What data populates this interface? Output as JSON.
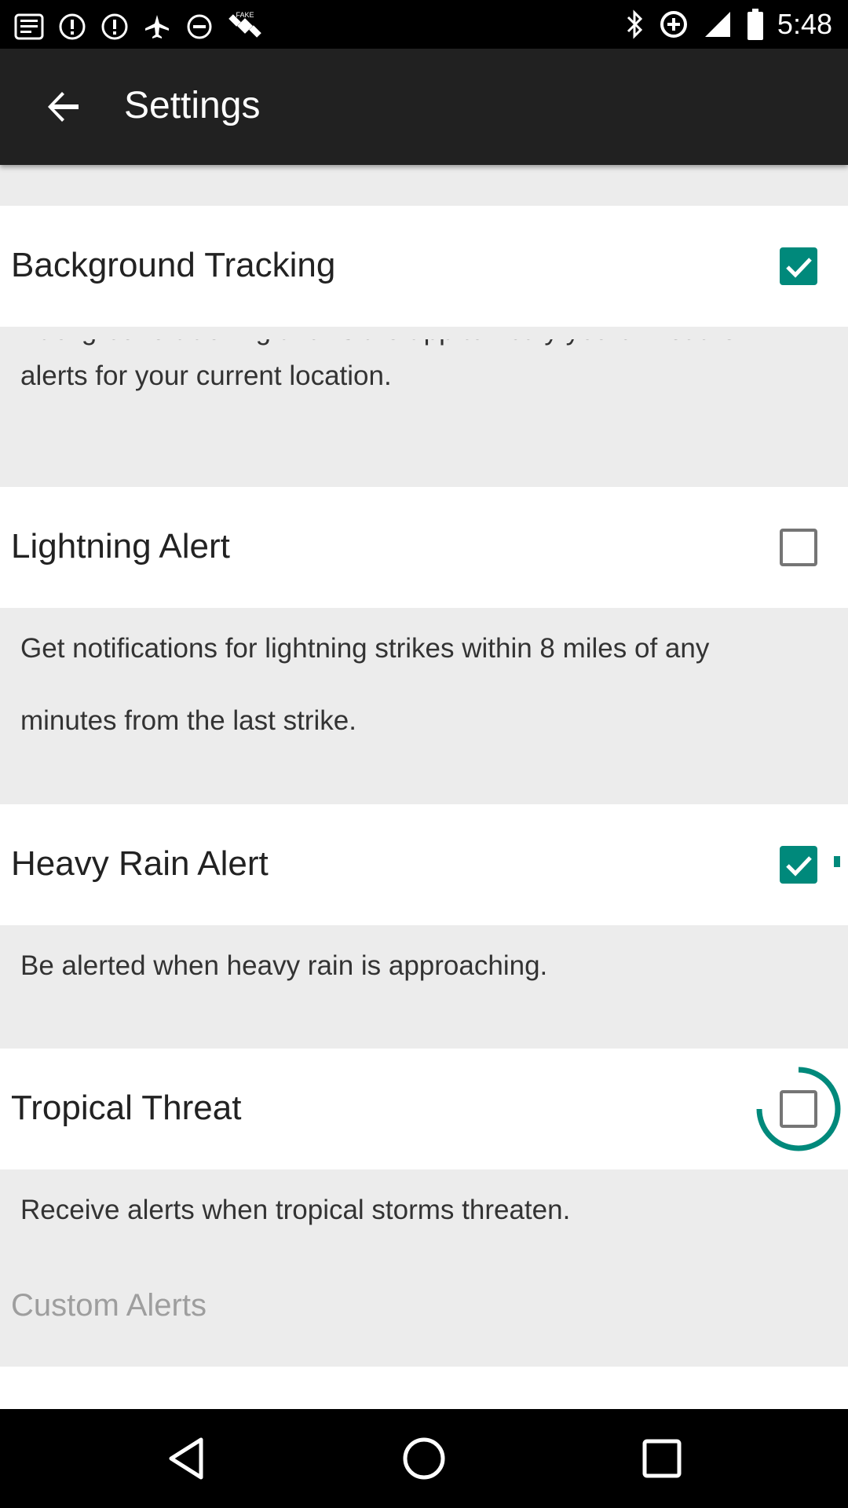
{
  "status_bar": {
    "time": "5:48",
    "left_icons": [
      "gallery-icon",
      "alert-icon",
      "alert-icon",
      "airplane-slash-icon",
      "circle-dash-icon",
      "fake-gps-icon"
    ],
    "right_icons": [
      "bluetooth-icon",
      "data-saver-icon",
      "signal-icon",
      "battery-icon"
    ]
  },
  "app_bar": {
    "title": "Settings",
    "back_icon": "arrow-back-icon"
  },
  "settings": [
    {
      "label": "Background Tracking",
      "checked": true,
      "description": "Background tracking allows the app to notify you of weather alerts for your current location."
    },
    {
      "label": "Lightning Alert",
      "checked": false,
      "description_lines": [
        "Get notifications for lightning strikes within 8 miles of any",
        "minutes from the last strike."
      ]
    },
    {
      "label": "Heavy Rain Alert",
      "checked": true,
      "description": "Be alerted when heavy rain is approaching."
    },
    {
      "label": "Tropical Threat",
      "checked": false,
      "description": "Receive alerts when tropical storms threaten."
    }
  ],
  "section_header": "Custom Alerts",
  "colors": {
    "accent": "#00897b",
    "app_bar": "#212121",
    "background": "#ececec"
  },
  "nav_bar": {
    "icons": [
      "back-triangle-icon",
      "home-circle-icon",
      "recents-square-icon"
    ]
  }
}
